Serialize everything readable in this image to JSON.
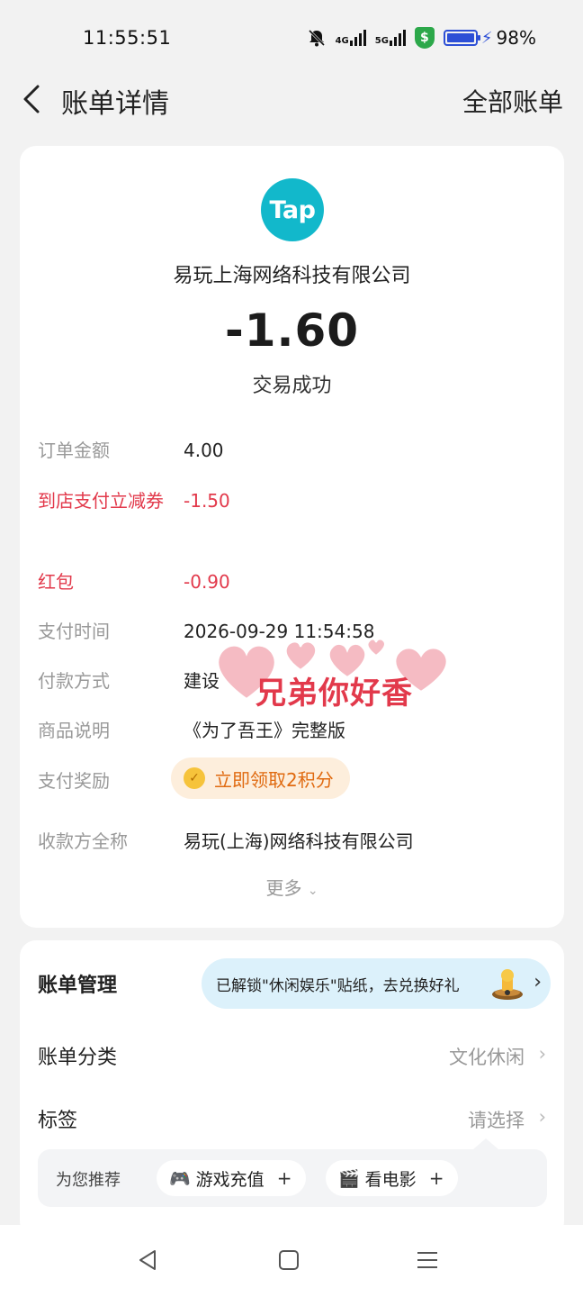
{
  "status_bar": {
    "time": "11:55:51",
    "net1": "4G",
    "net2": "5G",
    "shield_icon": "$",
    "battery": "98%"
  },
  "nav": {
    "title": "账单详情",
    "right_label": "全部账单"
  },
  "bill": {
    "logo_text": "Tap",
    "merchant": "易玩上海网络科技有限公司",
    "amount": "-1.60",
    "status": "交易成功",
    "rows": [
      {
        "label": "订单金额",
        "value": "4.00"
      },
      {
        "label": "到店支付立减券",
        "value": "-1.50"
      },
      {
        "label": "红包",
        "value": "-0.90"
      },
      {
        "label": "支付时间",
        "value": "2026-09-29 11:54:58"
      },
      {
        "label": "付款方式",
        "value": "建设"
      },
      {
        "label": "商品说明",
        "value": "《为了吾王》完整版"
      },
      {
        "label": "支付奖励",
        "value": "立即领取2积分"
      },
      {
        "label": "收款方全称",
        "value": "易玩(上海)网络科技有限公司"
      }
    ],
    "more": "更多",
    "watermark": "兄弟你好香"
  },
  "management": {
    "title": "账单管理",
    "banner": "已解锁\"休闲娱乐\"贴纸，去兑换好礼",
    "category_label": "账单分类",
    "category_value": "文化休闲",
    "tag_label": "标签",
    "tag_value": "请选择",
    "recommend_label": "为您推荐",
    "chips": [
      "游戏充值",
      "看电影"
    ]
  },
  "colors": {
    "accent_red": "#e2394b",
    "logo_teal": "#12b8cb",
    "banner_bg": "#dcf1fb"
  }
}
